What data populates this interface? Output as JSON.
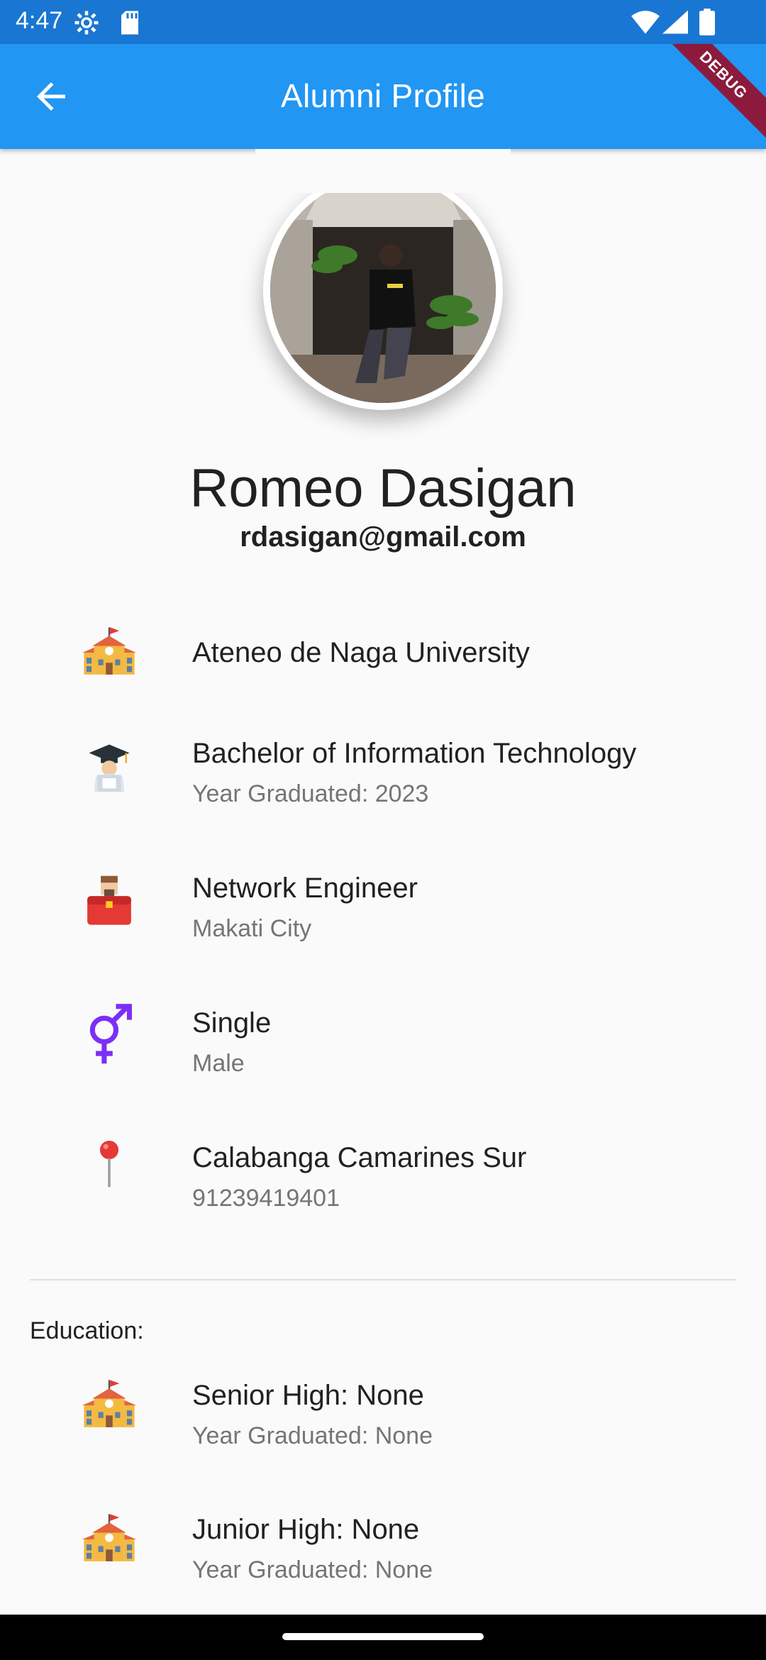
{
  "status_bar": {
    "time": "4:47",
    "icons": [
      "gear-icon",
      "sd-card-icon",
      "wifi-icon",
      "signal-icon",
      "battery-icon"
    ]
  },
  "app_bar": {
    "title": "Alumni Profile",
    "back_icon": "arrow-back-icon",
    "debug_label": "DEBUG",
    "color": "#2196f3"
  },
  "profile": {
    "name": "Romeo Dasigan",
    "email": "rdasigan@gmail.com"
  },
  "details": [
    {
      "icon": "school-icon",
      "title": "Ateneo de Naga University",
      "subtitle": ""
    },
    {
      "icon": "graduate-icon",
      "title": "Bachelor of Information Technology",
      "subtitle": "Year Graduated: 2023"
    },
    {
      "icon": "briefcase-icon",
      "title": "Network Engineer",
      "subtitle": "Makati City"
    },
    {
      "icon": "gender-icon",
      "title": "Single",
      "subtitle": "Male"
    },
    {
      "icon": "location-pin-icon",
      "title": "Calabanga Camarines Sur",
      "subtitle": "91239419401"
    }
  ],
  "education": {
    "label": "Education:",
    "items": [
      {
        "icon": "school-icon",
        "title": "Senior High: None",
        "subtitle": "Year Graduated: None"
      },
      {
        "icon": "school-icon",
        "title": "Junior High: None",
        "subtitle": "Year Graduated: None"
      }
    ]
  }
}
